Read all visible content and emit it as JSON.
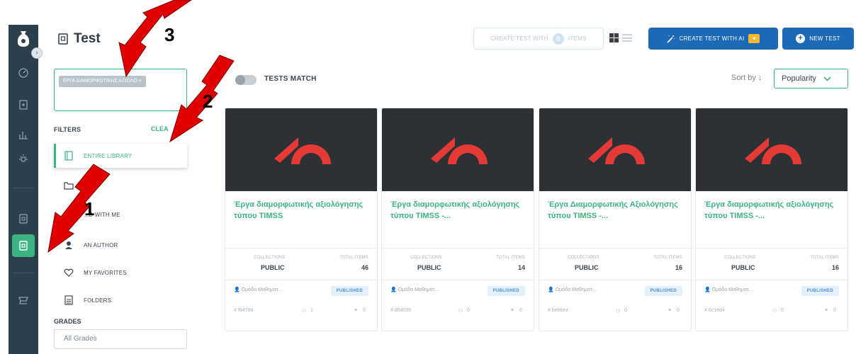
{
  "page": {
    "title": "Test"
  },
  "header": {
    "create_test_with": "CREATE TEST WITH",
    "selected_count": "0",
    "items": "ITEMS",
    "create_ai": "CREATE TEST WITH AI",
    "new_test": "NEW TEST"
  },
  "search": {
    "chip": "ΕΡΓΑ ΔΙΑΜΟΡΦΩΤΙΚΗΣ ΑΞΙΟΛΟ ×"
  },
  "filters": {
    "heading": "FILTERS",
    "clear": "CLEA",
    "items": [
      {
        "label": "ENTIRE LIBRARY"
      },
      {
        "label": "...E"
      },
      {
        "label": "...D WITH ME"
      },
      {
        "label": "AN AUTHOR"
      },
      {
        "label": "MY FAVORITES"
      },
      {
        "label": "FOLDERS"
      }
    ],
    "grades_heading": "GRADES",
    "grades_value": "All Grades"
  },
  "results": {
    "match_label": "TESTS MATCH",
    "sort_by": "Sort by",
    "sort_value": "Popularity"
  },
  "cards": [
    {
      "title": "Έργα διαμορφωτικής αξιολόγησης τύπου TIMSS",
      "collections_label": "COLLECTIONS",
      "collections": "PUBLIC",
      "items_label": "TOTAL ITEMS",
      "items": "46",
      "author": "Ομάδα Μαθηματ...",
      "status": "PUBLISHED",
      "id": "# f64788",
      "users": "1",
      "likes": "0"
    },
    {
      "title": "Έργα διαμορφωτικής αξιολόγησης τύπου TIMSS -...",
      "collections_label": "COLLECTIONS",
      "collections": "PUBLIC",
      "items_label": "TOTAL ITEMS",
      "items": "14",
      "author": "Ομάδα Μαθηματ...",
      "status": "PUBLISHED",
      "id": "# d6d035",
      "users": "0",
      "likes": "0"
    },
    {
      "title": "Έργα Διαμορφωτικής Αξιολόγησης τύπου TIMSS -...",
      "collections_label": "COLLECTIONS",
      "collections": "PUBLIC",
      "items_label": "TOTAL ITEMS",
      "items": "16",
      "author": "Ομάδα Μαθηματ...",
      "status": "PUBLISHED",
      "id": "# be6bez",
      "users": "0",
      "likes": "0"
    },
    {
      "title": "Έργα διαμορφωτικής αξιολόγησης τύπου TIMSS -...",
      "collections_label": "COLLECTIONS",
      "collections": "PUBLIC",
      "items_label": "TOTAL ITEMS",
      "items": "16",
      "author": "Ομάδα Μαθηματ...",
      "status": "PUBLISHED",
      "id": "# 6c1ed4",
      "users": "0",
      "likes": "0"
    }
  ],
  "annotations": {
    "a1": "1",
    "a2": "2",
    "a3": "3"
  },
  "icons": [
    "logo-bag-icon",
    "expand-icon",
    "dashboard-icon",
    "assignment-icon",
    "reports-icon",
    "insights-icon",
    "item-bank-icon",
    "test-library-icon",
    "marketplace-icon",
    "grid-view-icon",
    "list-view-icon",
    "magic-wand-icon",
    "plus-icon",
    "heart-icon",
    "user-icon",
    "group-icon",
    "folder-icon"
  ],
  "colors": {
    "accent": "#3bb482",
    "primary": "#1c69b5",
    "rail": "#2b3f4c",
    "annotation": "#e00000"
  }
}
